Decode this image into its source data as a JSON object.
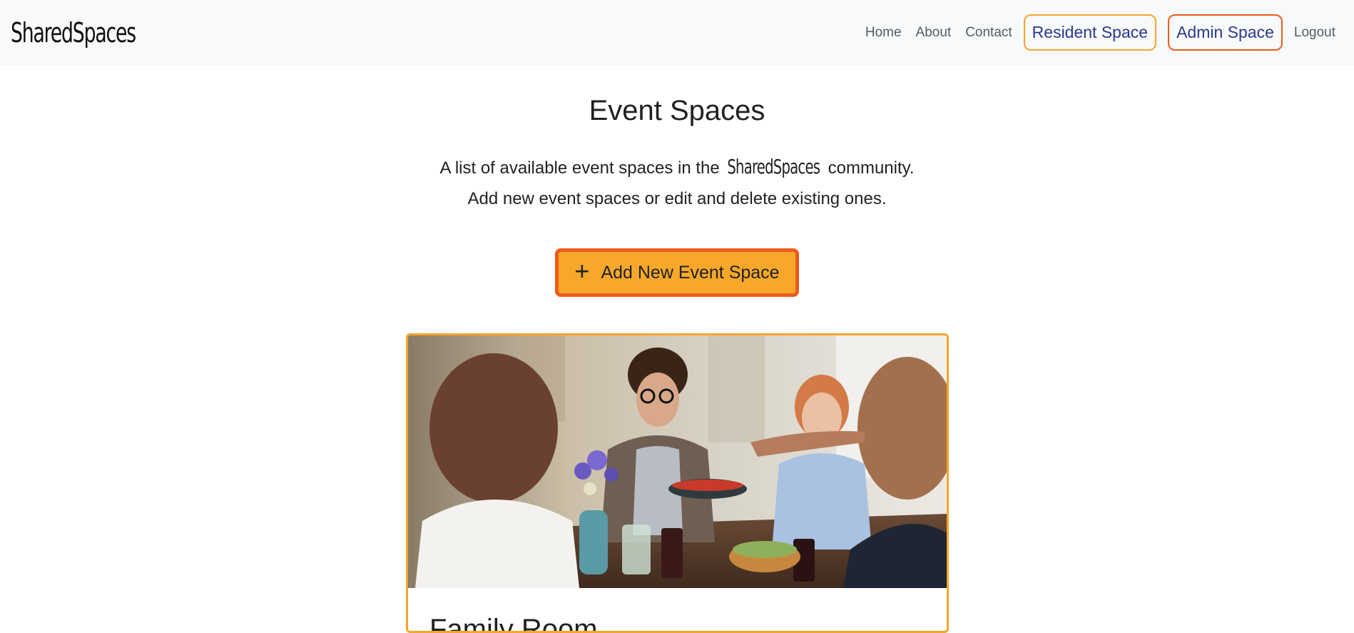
{
  "navbar": {
    "brand": "SharedSpaces",
    "links": {
      "home": "Home",
      "about": "About",
      "contact": "Contact",
      "resident": "Resident Space",
      "admin": "Admin Space",
      "logout": "Logout"
    }
  },
  "main": {
    "title": "Event Spaces",
    "intro_before": "A list of available event spaces in the",
    "intro_brand": "SharedSpaces",
    "intro_after": "community.",
    "intro_line2": "Add new event spaces or edit and delete existing ones.",
    "add_button_label": "Add New Event Space",
    "add_button_icon": "+"
  },
  "card": {
    "title": "Family Room"
  },
  "colors": {
    "accent_orange": "#f7a82a",
    "accent_red_orange": "#ee5a1c",
    "link_blue": "#2a3a8c",
    "navbar_bg": "#f8f9fa"
  }
}
